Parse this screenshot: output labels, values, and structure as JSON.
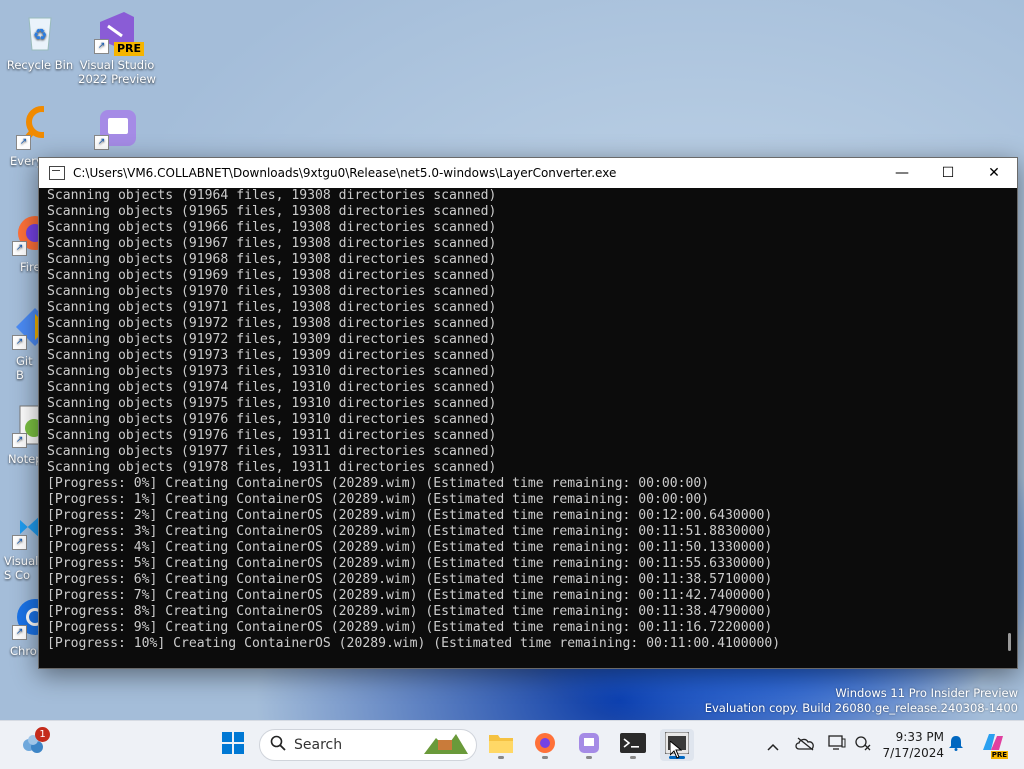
{
  "desktop": {
    "icons": [
      {
        "label": "Recycle Bin"
      },
      {
        "label": "Visual Studio 2022 Preview",
        "badge": "PRE"
      },
      {
        "label": "Every"
      },
      {
        "label": ""
      },
      {
        "label": "Fire"
      },
      {
        "label": "Git B"
      },
      {
        "label": "Notep"
      },
      {
        "label": "Visual S Co"
      },
      {
        "label": "Chro"
      }
    ]
  },
  "console": {
    "title": "C:\\Users\\VM6.COLLABNET\\Downloads\\9xtgu0\\Release\\net5.0-windows\\LayerConverter.exe",
    "minimize": "—",
    "maximize": "☐",
    "close": "✕",
    "lines": [
      "Scanning objects (91964 files, 19308 directories scanned)",
      "Scanning objects (91965 files, 19308 directories scanned)",
      "Scanning objects (91966 files, 19308 directories scanned)",
      "Scanning objects (91967 files, 19308 directories scanned)",
      "Scanning objects (91968 files, 19308 directories scanned)",
      "Scanning objects (91969 files, 19308 directories scanned)",
      "Scanning objects (91970 files, 19308 directories scanned)",
      "Scanning objects (91971 files, 19308 directories scanned)",
      "Scanning objects (91972 files, 19308 directories scanned)",
      "Scanning objects (91972 files, 19309 directories scanned)",
      "Scanning objects (91973 files, 19309 directories scanned)",
      "Scanning objects (91973 files, 19310 directories scanned)",
      "Scanning objects (91974 files, 19310 directories scanned)",
      "Scanning objects (91975 files, 19310 directories scanned)",
      "Scanning objects (91976 files, 19310 directories scanned)",
      "Scanning objects (91976 files, 19311 directories scanned)",
      "Scanning objects (91977 files, 19311 directories scanned)",
      "Scanning objects (91978 files, 19311 directories scanned)",
      "[Progress: 0%] Creating ContainerOS (20289.wim) (Estimated time remaining: 00:00:00)",
      "[Progress: 1%] Creating ContainerOS (20289.wim) (Estimated time remaining: 00:00:00)",
      "[Progress: 2%] Creating ContainerOS (20289.wim) (Estimated time remaining: 00:12:00.6430000)",
      "[Progress: 3%] Creating ContainerOS (20289.wim) (Estimated time remaining: 00:11:51.8830000)",
      "[Progress: 4%] Creating ContainerOS (20289.wim) (Estimated time remaining: 00:11:50.1330000)",
      "[Progress: 5%] Creating ContainerOS (20289.wim) (Estimated time remaining: 00:11:55.6330000)",
      "[Progress: 6%] Creating ContainerOS (20289.wim) (Estimated time remaining: 00:11:38.5710000)",
      "[Progress: 7%] Creating ContainerOS (20289.wim) (Estimated time remaining: 00:11:42.7400000)",
      "[Progress: 8%] Creating ContainerOS (20289.wim) (Estimated time remaining: 00:11:38.4790000)",
      "[Progress: 9%] Creating ContainerOS (20289.wim) (Estimated time remaining: 00:11:16.7220000)",
      "[Progress: 10%] Creating ContainerOS (20289.wim) (Estimated time remaining: 00:11:00.4100000)"
    ]
  },
  "watermark": {
    "line1": "Windows 11 Pro Insider Preview",
    "line2": "Evaluation copy. Build 26080.ge_release.240308-1400"
  },
  "taskbar": {
    "widgets_badge": "1",
    "search_label": "Search",
    "icons": [
      "widgets-icon",
      "start-icon",
      "search-icon",
      "file-explorer-icon",
      "firefox-icon",
      "app-icon",
      "terminal-icon",
      "layer-converter-icon"
    ],
    "tray": {
      "time": "9:33 PM",
      "date": "7/17/2024",
      "icons": [
        "chevron-up-icon",
        "onedrive-icon",
        "display-icon",
        "network-icon",
        "notification-bell-icon",
        "copilot-icon"
      ],
      "copilot_badge": "PRE"
    }
  },
  "colors": {
    "console_bg": "#0c0c0c",
    "console_text": "#cccccc",
    "taskbar_bg": "#eef1f6",
    "accent": "#0067c0"
  }
}
